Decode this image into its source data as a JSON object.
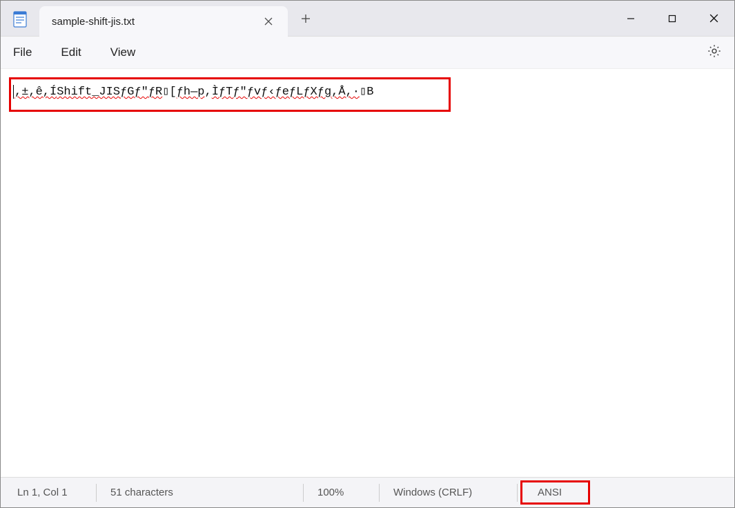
{
  "titlebar": {
    "tab_title": "sample-shift-jis.txt"
  },
  "menubar": {
    "file": "File",
    "edit": "Edit",
    "view": "View"
  },
  "editor": {
    "content_raw": "‚±‚ê‚ÍShift_JISƒGƒ\"ƒR▯[ƒh—p‚ÌƒTƒ\"ƒvƒ‹ƒeƒLƒXƒg‚Å‚·▯B",
    "segments": [
      {
        "text": ",±,ê,Í",
        "wavy": true
      },
      {
        "text": "Shift_JIS",
        "wavy": true
      },
      {
        "text": "ƒGƒ\"ƒR",
        "wavy": true
      },
      {
        "text": "▯[",
        "wavy": false
      },
      {
        "text": "ƒh—p",
        "wavy": true
      },
      {
        "text": ",",
        "wavy": false
      },
      {
        "text": "ÌƒTƒ\"ƒvƒ‹ƒeƒLƒXƒg",
        "wavy": true
      },
      {
        "text": ",Å,·",
        "wavy": true
      },
      {
        "text": "▯B",
        "wavy": false
      }
    ]
  },
  "statusbar": {
    "position": "Ln 1, Col 1",
    "chars": "51 characters",
    "zoom": "100%",
    "line_ending": "Windows (CRLF)",
    "encoding": "ANSI"
  }
}
